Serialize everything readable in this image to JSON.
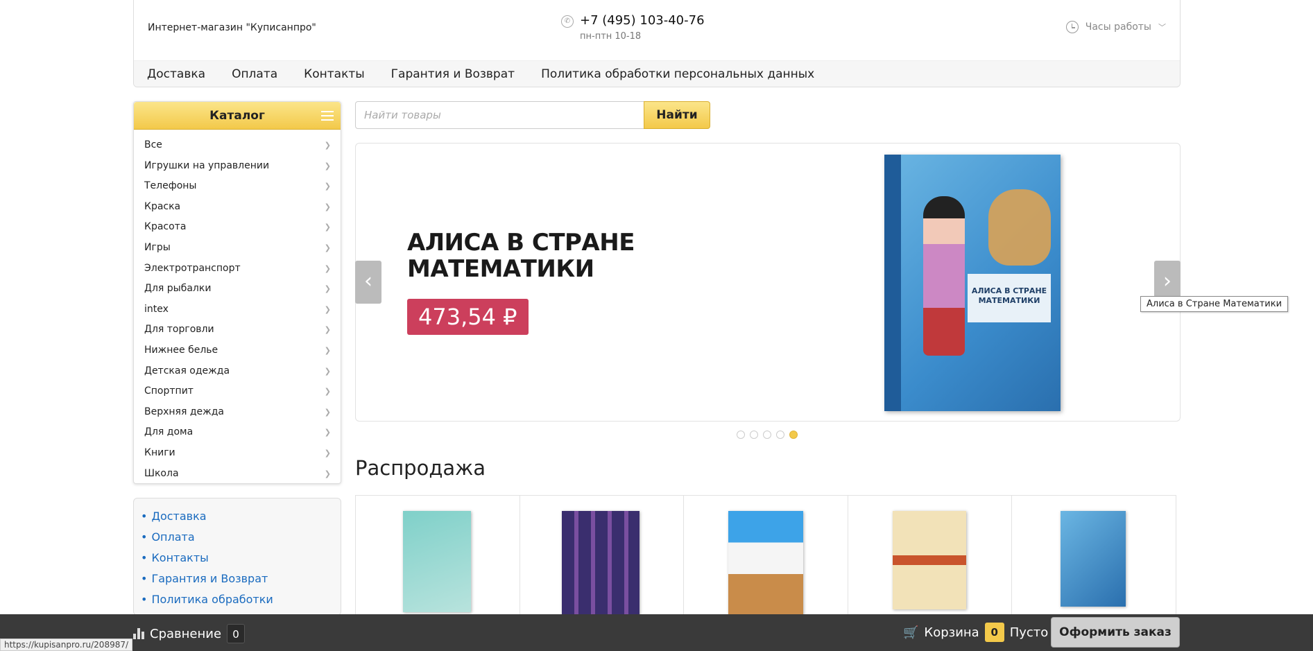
{
  "header": {
    "shop_name": "Интернет-магазин \"Куписанпро\"",
    "phone": "+7 (495) 103-40-76",
    "hours": "пн-птн 10-18",
    "work_hours_label": "Часы работы"
  },
  "topnav": [
    "Доставка",
    "Оплата",
    "Контакты",
    "Гарантия и Возврат",
    "Политика обработки персональных данных"
  ],
  "catalog": {
    "title": "Каталог",
    "items": [
      "Все",
      "Игрушки на управлении",
      "Телефоны",
      "Краска",
      "Красота",
      "Игры",
      "Электротранспорт",
      "Для рыбалки",
      "intex",
      "Для торговли",
      "Нижнее белье",
      "Детская одежда",
      "Спортпит",
      "Верхняя дежда",
      "Для дома",
      "Книги",
      "Школа"
    ]
  },
  "side_links": [
    "Доставка",
    "Оплата",
    "Контакты",
    "Гарантия и Возврат",
    "Политика обработки"
  ],
  "search": {
    "placeholder": "Найти товары",
    "button": "Найти"
  },
  "slider": {
    "title_line1": "АЛИСА В СТРАНЕ",
    "title_line2": "МАТЕМАТИКИ",
    "price": "473,54 ₽",
    "book_label": "АЛИСА В СТРАНЕ МАТЕМАТИКИ",
    "tooltip": "Алиса в Стране Математики",
    "dots_total": 5,
    "active_dot": 5
  },
  "sale": {
    "title": "Распродажа"
  },
  "bottom_bar": {
    "compare_label": "Сравнение",
    "compare_count": "0",
    "cart_label": "Корзина",
    "cart_count": "0",
    "cart_status": "Пусто",
    "order_button": "Оформить заказ"
  },
  "status_url": "https://kupisanpro.ru/208987/",
  "colors": {
    "accent_yellow": "#f3c94a",
    "price_bg": "#cc3f5c",
    "link": "#1a6bbf",
    "bottom_bar": "#3a3a3a"
  }
}
